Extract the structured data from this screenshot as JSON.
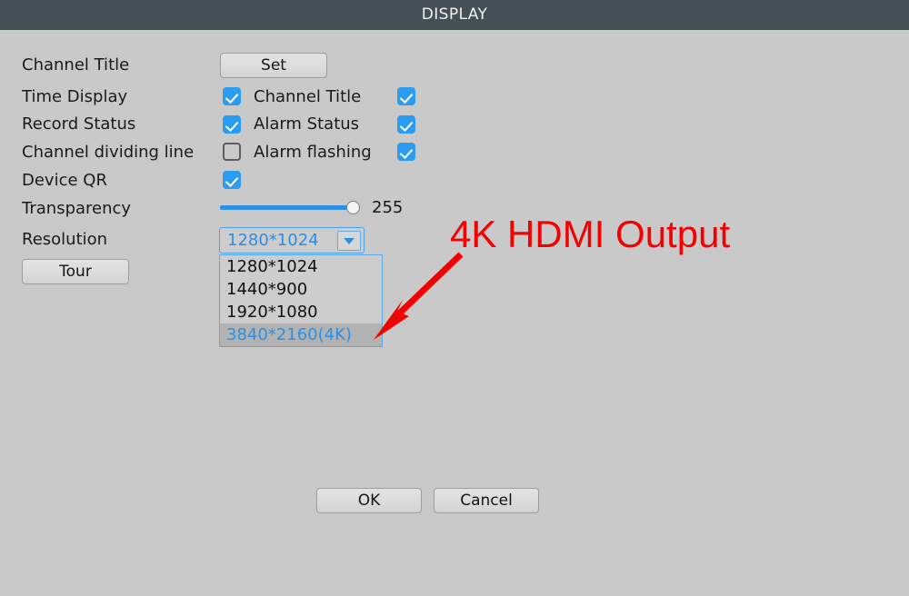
{
  "window": {
    "title": "DISPLAY"
  },
  "rows": {
    "channel_title": {
      "label": "Channel Title",
      "set_button": "Set"
    },
    "time_display": {
      "label": "Time Display",
      "checked": true,
      "right_label": "Channel Title",
      "right_checked": true
    },
    "record_status": {
      "label": "Record Status",
      "checked": true,
      "right_label": "Alarm Status",
      "right_checked": true
    },
    "channel_dividing_line": {
      "label": "Channel dividing line",
      "checked": false,
      "right_label": "Alarm flashing",
      "right_checked": true
    },
    "device_qr": {
      "label": "Device QR",
      "checked": true
    },
    "transparency": {
      "label": "Transparency",
      "value": "255",
      "percent": 100
    },
    "resolution": {
      "label": "Resolution",
      "selected": "1280*1024",
      "options": [
        "1280*1024",
        "1440*900",
        "1920*1080",
        "3840*2160(4K)"
      ],
      "highlighted_option": "3840*2160(4K)"
    },
    "tour": {
      "label": "Tour"
    }
  },
  "footer": {
    "ok_label": "OK",
    "cancel_label": "Cancel"
  },
  "annotation": {
    "text": "4K HDMI Output",
    "color": "#f50000"
  },
  "colors": {
    "titlebar_bg": "#454f56",
    "dialog_bg": "#c9c9c9",
    "accent_blue": "#2b8fe6",
    "checkbox_blue": "#2b9cf0",
    "annotation_red": "#f50000"
  }
}
